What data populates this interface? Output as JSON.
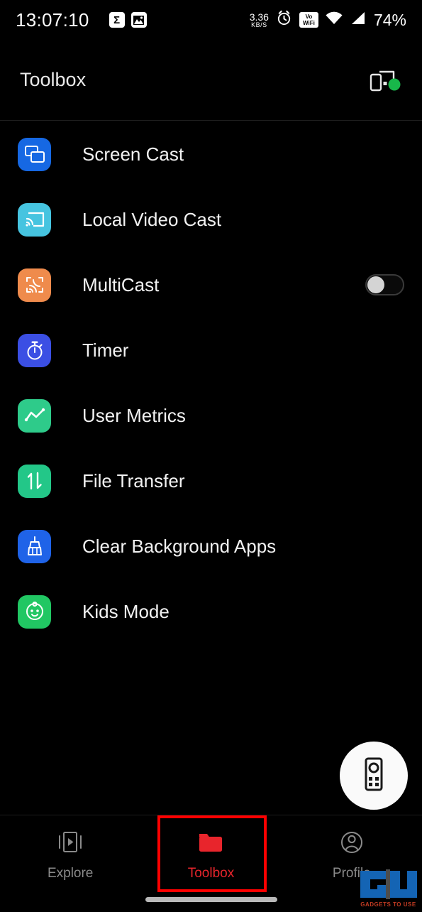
{
  "status_bar": {
    "clock": "13:07:10",
    "notification_icons": [
      "sigma-icon",
      "image-icon"
    ],
    "network_rate": "3.36",
    "network_unit": "KB/S",
    "alarm_icon": "alarm-clock-icon",
    "volte_line1": "Vo",
    "volte_line2": "WiFi",
    "wifi_icon": "wifi-icon",
    "signal_icon": "cellular-signal-icon",
    "battery": "74%"
  },
  "header": {
    "title": "Toolbox",
    "cast_icon": "cast-device-icon",
    "status_dot_color": "#18b84a"
  },
  "list": {
    "items": [
      {
        "label": "Screen Cast",
        "icon": "screen-cast-icon",
        "color": "#1668e3",
        "has_toggle": false
      },
      {
        "label": "Local Video Cast",
        "icon": "local-video-cast-icon",
        "color": "#46c4e0",
        "has_toggle": false
      },
      {
        "label": "MultiCast",
        "icon": "multicast-icon",
        "color": "#ef8b4c",
        "has_toggle": true,
        "toggle_on": false
      },
      {
        "label": "Timer",
        "icon": "stopwatch-icon",
        "color": "#3b4fe4",
        "has_toggle": false
      },
      {
        "label": "User Metrics",
        "icon": "line-chart-icon",
        "color": "#2ecb8a",
        "has_toggle": false
      },
      {
        "label": "File Transfer",
        "icon": "transfer-arrows-icon",
        "color": "#23c788",
        "has_toggle": false
      },
      {
        "label": "Clear Background Apps",
        "icon": "broom-icon",
        "color": "#1f63e8",
        "has_toggle": false
      },
      {
        "label": "Kids Mode",
        "icon": "baby-face-icon",
        "color": "#21c763",
        "has_toggle": false
      }
    ]
  },
  "fab": {
    "icon": "remote-control-icon"
  },
  "bottom_nav": {
    "items": [
      {
        "label": "Explore",
        "icon": "video-explore-icon",
        "active": false
      },
      {
        "label": "Toolbox",
        "icon": "folder-icon",
        "active": true
      },
      {
        "label": "Profile",
        "icon": "person-circle-icon",
        "active": false
      }
    ],
    "active_color": "#e8252c",
    "inactive_color": "#8a8a8a"
  },
  "watermark": {
    "logo": "GU",
    "text": "GADGETS TO USE"
  }
}
